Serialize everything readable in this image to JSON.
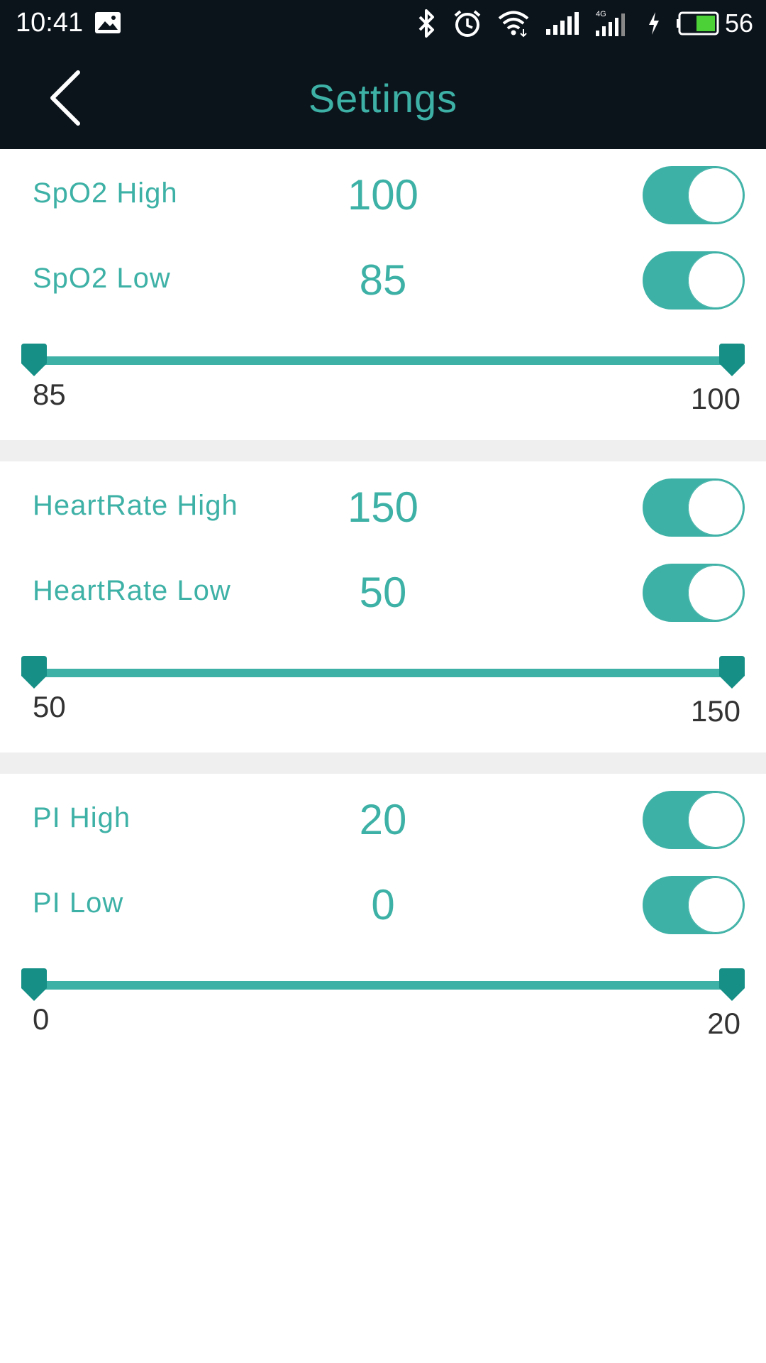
{
  "status_bar": {
    "time": "10:41",
    "battery": "56",
    "icons": [
      "image-notification-icon",
      "bluetooth-icon",
      "alarm-icon",
      "wifi-icon",
      "signal-icon",
      "signal-4g-icon",
      "charging-icon",
      "battery-icon"
    ]
  },
  "header": {
    "title": "Settings",
    "back_icon": "chevron-left-icon"
  },
  "colors": {
    "accent": "#3eb1a6",
    "thumb": "#168f86",
    "bar": "#0b131b",
    "divider": "#efefef",
    "battery_fill": "#4cd137"
  },
  "sections": [
    {
      "high": {
        "label": "SpO2 High",
        "value": "100",
        "enabled": true
      },
      "low": {
        "label": "SpO2 Low",
        "value": "85",
        "enabled": true
      },
      "range": {
        "min_label": "85",
        "max_label": "100"
      }
    },
    {
      "high": {
        "label": "HeartRate High",
        "value": "150",
        "enabled": true
      },
      "low": {
        "label": "HeartRate Low",
        "value": "50",
        "enabled": true
      },
      "range": {
        "min_label": "50",
        "max_label": "150"
      }
    },
    {
      "high": {
        "label": "PI High",
        "value": "20",
        "enabled": true
      },
      "low": {
        "label": "PI Low",
        "value": "0",
        "enabled": true
      },
      "range": {
        "min_label": "0",
        "max_label": "20"
      }
    }
  ]
}
